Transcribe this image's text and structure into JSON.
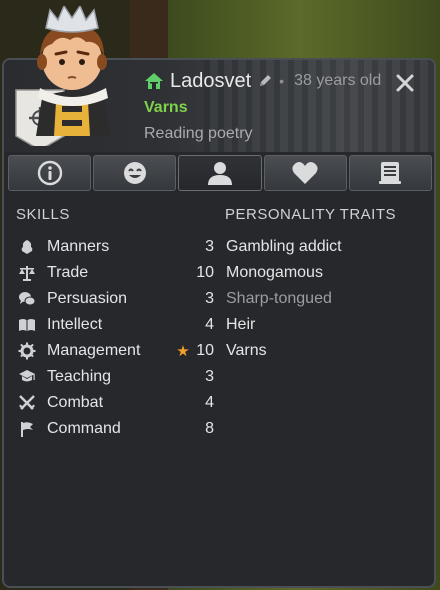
{
  "character": {
    "name": "Ladosvet",
    "age_text": "38 years old",
    "faction": "Varns",
    "activity": "Reading poetry"
  },
  "colors": {
    "faction": "#7fd24a",
    "star": "#f2a12a",
    "home_icon": "#5fcf6a"
  },
  "tabs": [
    {
      "icon": "info-icon"
    },
    {
      "icon": "mood-icon"
    },
    {
      "icon": "person-icon",
      "active": true
    },
    {
      "icon": "heart-icon"
    },
    {
      "icon": "log-icon"
    }
  ],
  "skills": {
    "title": "SKILLS",
    "items": [
      {
        "name": "Manners",
        "value": "3",
        "icon": "manners-icon"
      },
      {
        "name": "Trade",
        "value": "10",
        "icon": "scales-icon"
      },
      {
        "name": "Persuasion",
        "value": "3",
        "icon": "speech-bubbles-icon"
      },
      {
        "name": "Intellect",
        "value": "4",
        "icon": "book-icon"
      },
      {
        "name": "Management",
        "value": "10",
        "icon": "gear-icon",
        "star": "★"
      },
      {
        "name": "Teaching",
        "value": "3",
        "icon": "graduation-cap-icon"
      },
      {
        "name": "Combat",
        "value": "4",
        "icon": "crossed-swords-icon"
      },
      {
        "name": "Command",
        "value": "8",
        "icon": "flag-icon"
      }
    ]
  },
  "traits": {
    "title": "PERSONALITY TRAITS",
    "items": [
      {
        "name": "Gambling addict",
        "muted": false
      },
      {
        "name": "Monogamous",
        "muted": false
      },
      {
        "name": "Sharp-tongued",
        "muted": true
      },
      {
        "name": "Heir",
        "muted": false
      },
      {
        "name": "Varns",
        "muted": false
      }
    ]
  }
}
